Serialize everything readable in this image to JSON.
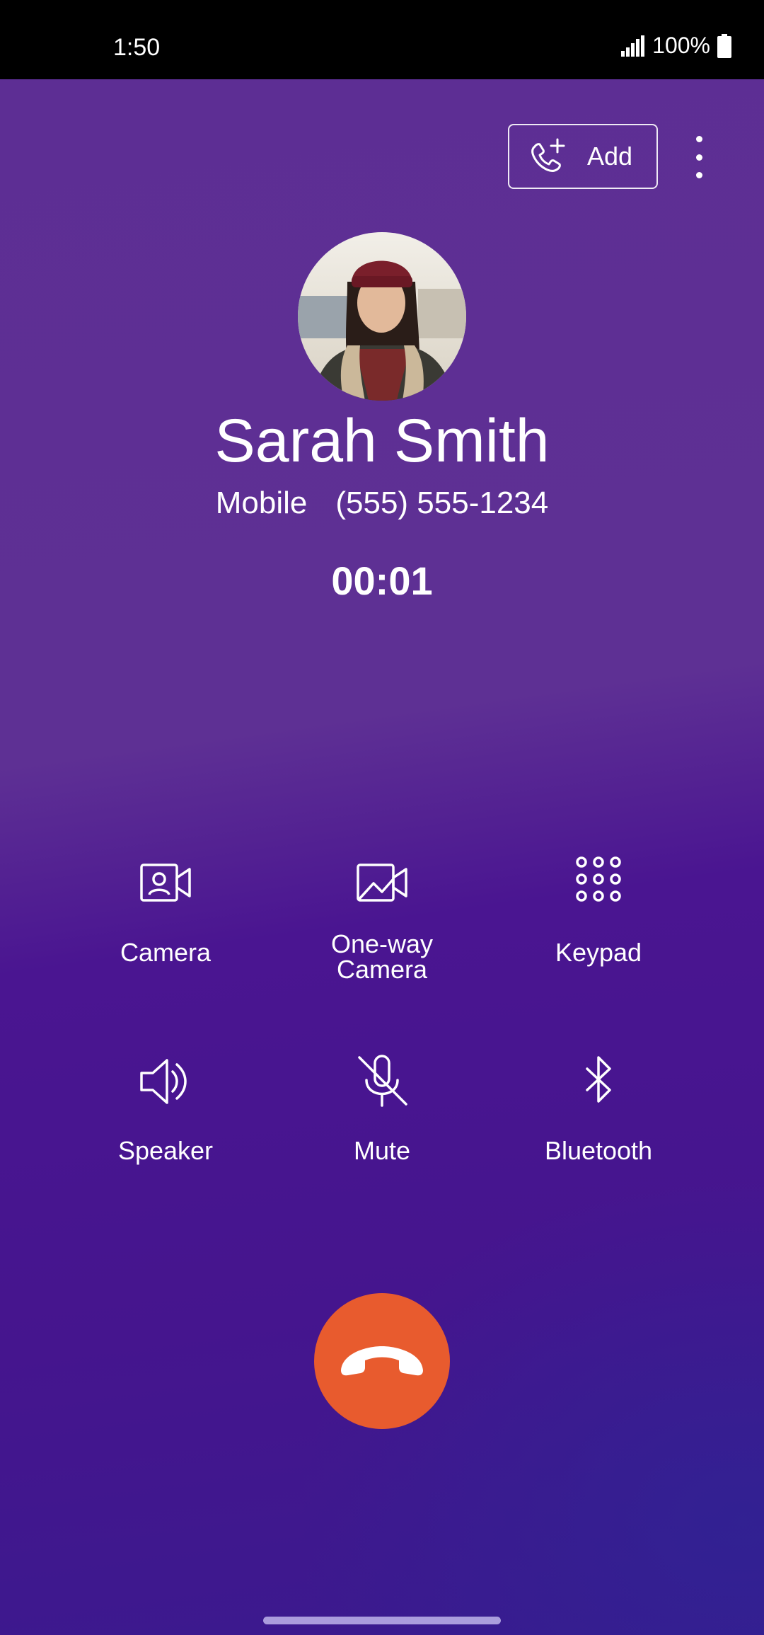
{
  "status_bar": {
    "time": "1:50",
    "battery": "100%"
  },
  "header": {
    "add_label": "Add"
  },
  "contact": {
    "name": "Sarah Smith",
    "number_type": "Mobile",
    "number": "(555) 555-1234",
    "call_duration": "00:01"
  },
  "actions": {
    "camera": "Camera",
    "one_way_camera_line1": "One-way",
    "one_way_camera_line2": "Camera",
    "keypad": "Keypad",
    "speaker": "Speaker",
    "mute": "Mute",
    "bluetooth": "Bluetooth"
  },
  "colors": {
    "background_top": "#5e3094",
    "background_bottom": "#3a1a8e",
    "end_call": "#e85b2e"
  },
  "icons": [
    "signal-icon",
    "battery-icon",
    "add-call-icon",
    "more-vert-icon",
    "camera-icon",
    "one-way-camera-icon",
    "keypad-icon",
    "speaker-icon",
    "mute-icon",
    "bluetooth-icon",
    "end-call-icon"
  ]
}
